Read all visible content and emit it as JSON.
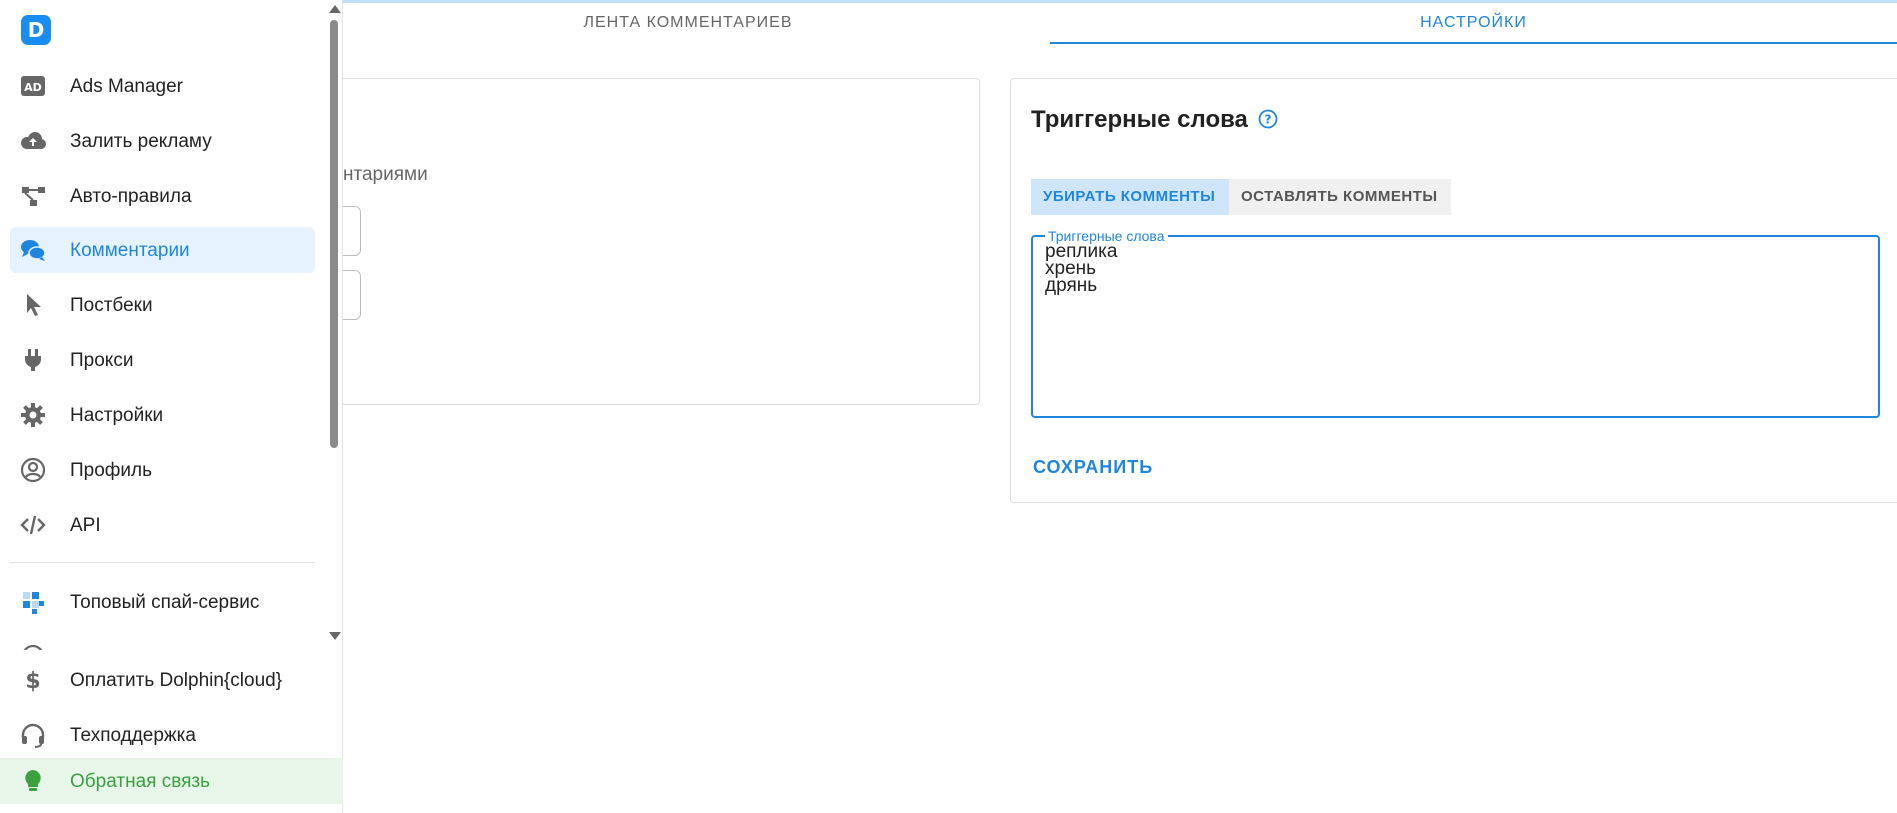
{
  "sidebar": {
    "logo": "D",
    "items": [
      {
        "label": "Ads Manager",
        "icon": "ad-icon"
      },
      {
        "label": "Залить рекламу",
        "icon": "cloud-upload-icon"
      },
      {
        "label": "Авто-правила",
        "icon": "flow-icon"
      },
      {
        "label": "Комментарии",
        "icon": "comments-icon",
        "active": true
      },
      {
        "label": "Постбеки",
        "icon": "cursor-icon"
      },
      {
        "label": "Прокси",
        "icon": "plug-icon"
      },
      {
        "label": "Настройки",
        "icon": "gear-icon"
      },
      {
        "label": "Профиль",
        "icon": "user-icon"
      },
      {
        "label": "API",
        "icon": "code-icon"
      },
      {
        "label": "Топовый спай-сервис",
        "icon": "spy-service-icon"
      }
    ],
    "bottom_items": [
      {
        "label": "Оплатить Dolphin{cloud}",
        "icon": "dollar-icon"
      },
      {
        "label": "Техподдержка",
        "icon": "headset-icon"
      },
      {
        "label": "Обратная связь",
        "icon": "lightbulb-icon"
      }
    ]
  },
  "tabs": {
    "feed": "ЛЕНТА КОММЕНТАРИЕВ",
    "settings": "НАСТРОЙКИ"
  },
  "left_card": {
    "text": "нтариями"
  },
  "trigger_card": {
    "title": "Триггерные слова",
    "remove_label": "УБИРАТЬ КОММЕНТЫ",
    "keep_label": "ОСТАВЛЯТЬ КОММЕНТЫ",
    "textarea_label": "Триггерные слова",
    "textarea_value": "реплика\nхрень\nдрянь",
    "save_label": "СОХРАНИТЬ"
  },
  "colors": {
    "accent": "#1f86dd",
    "active_bg": "#e6f2fd",
    "feedback_green": "#3aa040"
  }
}
